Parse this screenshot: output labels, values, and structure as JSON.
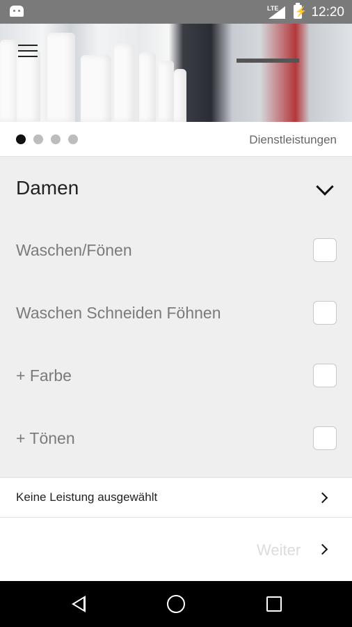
{
  "status_bar": {
    "network": "LTE",
    "time": "12:20",
    "icons": [
      "android-icon",
      "signal-icon",
      "battery-charging-icon"
    ]
  },
  "header": {
    "menu_icon": "menu-icon",
    "pager": {
      "page_count": 4,
      "active_index": 0,
      "title": "Dienstleistungen"
    }
  },
  "category": {
    "title": "Damen",
    "expanded": true,
    "icon": "chevron-down-icon"
  },
  "services": [
    {
      "label": "Waschen/Fönen",
      "checked": false
    },
    {
      "label": "Waschen Schneiden Föhnen",
      "checked": false
    },
    {
      "label": "+ Farbe",
      "checked": false
    },
    {
      "label": "+ Tönen",
      "checked": false
    }
  ],
  "summary": {
    "label": "Keine Leistung ausgewählt",
    "icon": "chevron-right-icon"
  },
  "next": {
    "label": "Weiter",
    "enabled": false,
    "icon": "chevron-right-icon"
  },
  "nav_bar": {
    "icons": [
      "back-icon",
      "home-icon",
      "recents-icon"
    ]
  },
  "colors": {
    "status_bar": "#7a7a7a",
    "list_background": "#efefef",
    "active_dot": "#111111",
    "inactive_dot": "#bdbdbd",
    "disabled_text": "#dcdcdc"
  }
}
